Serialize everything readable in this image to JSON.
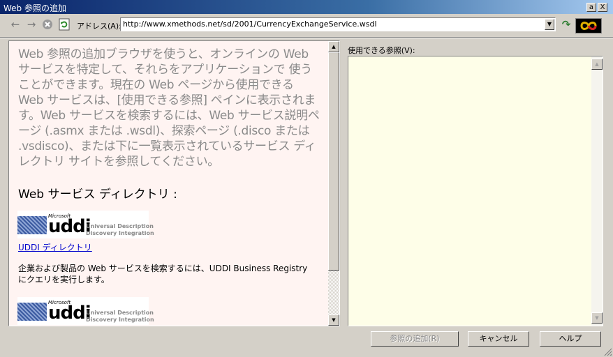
{
  "window": {
    "title": "Web 参照の追加",
    "title_buttons": [
      "a",
      "X"
    ]
  },
  "toolbar": {
    "address_label": "アドレス(A):",
    "address_value": "http://www.xmethods.net/sd/2001/CurrencyExchangeService.wsdl",
    "icons": [
      "back-arrow-icon",
      "forward-arrow-icon",
      "stop-icon",
      "refresh-icon",
      "go-arrow-icon",
      "vs-logo-icon"
    ]
  },
  "left_pane": {
    "intro_text": "Web 参照の追加ブラウザを使うと、オンラインの Web サービスを特定して、それらをアプリケーションで 使うことができます。現在の Web ページから使用できる Web サービスは、[使用できる参照] ペインに表示されます。Web サービスを検索するには、Web サービス説明ページ (.asmx または .wsdl)、探索ページ (.disco または .vsdisco)、または下に一覧表示されているサービス ディレクトリ サイトを参照してください。",
    "directory_heading": "Web サービス ディレクトリ :",
    "logo_microsoft": "Microsoft",
    "logo_word": "uddi",
    "logo_line1": "Universal Description",
    "logo_line2": "Discovery Integration",
    "uddi_link": "UDDI ディレクトリ",
    "uddi_description": "企業および製品の Web サービスを検索するには、UDDI Business Registry にクエリを実行します。"
  },
  "right_pane": {
    "label": "使用できる参照(V):"
  },
  "buttons": {
    "add_reference": "参照の追加(R)",
    "cancel": "キャンセル",
    "help": "ヘルプ"
  }
}
